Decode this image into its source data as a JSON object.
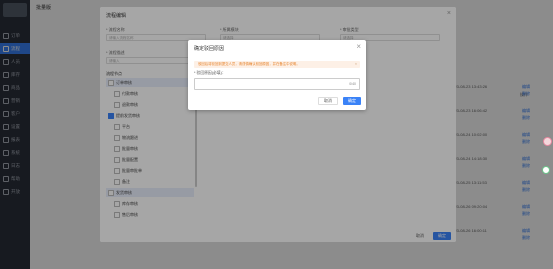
{
  "sidebar": {
    "items": [
      {
        "label": "订单"
      },
      {
        "label": "流程"
      },
      {
        "label": "人员"
      },
      {
        "label": "库存"
      },
      {
        "label": "商品"
      },
      {
        "label": "营销"
      },
      {
        "label": "客户"
      },
      {
        "label": "设置"
      },
      {
        "label": "报表"
      },
      {
        "label": "系统"
      },
      {
        "label": "日志"
      },
      {
        "label": "帮助"
      },
      {
        "label": "开放"
      }
    ],
    "active_index": 1
  },
  "header": {
    "title": "批量版"
  },
  "background": {
    "times": [
      "2023-08-23 13:43:26",
      "2023-08-23 16:06:42",
      "2023-08-24 10:02:00",
      "2023-08-24 14:18:30",
      "2023-08-25 13:11:53",
      "2023-08-26 09:20:04",
      "2023-08-26 16:00:11"
    ],
    "actions": [
      "编辑",
      "删除"
    ],
    "col_header": "操作"
  },
  "dialog1": {
    "title": "流程编辑",
    "fields": [
      {
        "label": "* 流程名称",
        "placeholder": "请输入流程名称"
      },
      {
        "label": "* 所属模块",
        "placeholder": "请选择"
      },
      {
        "label": "* 流程描述",
        "placeholder": "请输入"
      },
      {
        "label": "* 审批类型",
        "placeholder": "请选择"
      }
    ],
    "tree_title": "流程节点",
    "tree": [
      {
        "label": "订单审核",
        "level": 0,
        "checked": false,
        "selected": true
      },
      {
        "label": "付款审核",
        "level": 1,
        "checked": false,
        "selected": false
      },
      {
        "label": "退款审核",
        "level": 1,
        "checked": false,
        "selected": false
      },
      {
        "label": "提前发货审核",
        "level": 0,
        "checked": true,
        "selected": false
      },
      {
        "label": "平台",
        "level": 1,
        "checked": false,
        "selected": false
      },
      {
        "label": "物流跟进",
        "level": 1,
        "checked": false,
        "selected": false
      },
      {
        "label": "批量审核",
        "level": 1,
        "checked": false,
        "selected": false
      },
      {
        "label": "批量配置",
        "level": 1,
        "checked": false,
        "selected": false
      },
      {
        "label": "批量审批单",
        "level": 1,
        "checked": false,
        "selected": false
      },
      {
        "label": "备注",
        "level": 1,
        "checked": false,
        "selected": false
      },
      {
        "label": "发货审核",
        "level": 0,
        "checked": false,
        "selected": true
      },
      {
        "label": "库存审核",
        "level": 1,
        "checked": false,
        "selected": false
      },
      {
        "label": "售后审核",
        "level": 1,
        "checked": false,
        "selected": false
      }
    ],
    "cancel_label": "取消",
    "confirm_label": "确定"
  },
  "dialog2": {
    "title": "确定驳回原因",
    "alert": "驳回后将驳回到提交人员，请谨慎确认驳回原因，并在备注中说明。",
    "field_label": "* 驳回原因(必填)：",
    "count": "0/40",
    "cancel_label": "取消",
    "confirm_label": "确定"
  },
  "colors": {
    "primary": "#3a82f7",
    "warning_bg": "#fdf0e6",
    "warning_text": "#e6822a",
    "sidebar_bg": "#2b303b"
  }
}
